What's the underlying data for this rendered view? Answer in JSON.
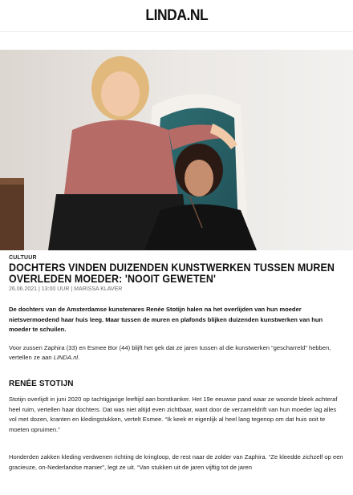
{
  "header": {
    "logo_text": "LINDA.NL"
  },
  "hero": {
    "image": "photo-two-women-mother-daughters"
  },
  "article": {
    "category": "CULTUUR",
    "title": "DOCHTERS VINDEN DUIZENDEN KUNSTWERKEN TUSSEN MUREN OVERLEDEN MOEDER: 'NOOIT GEWETEN'",
    "date": "26.06.2021",
    "time": "13:00 UUR",
    "author": "MARISSA KLAVER",
    "meta_sep": "|",
    "lead": "De dochters van de Amsterdamse kunstenares Renée Stotijn halen na het overlijden van hun moeder nietsvermoedend haar huis leeg. Maar tussen de muren en plafonds blijken duizenden kunstwerken van hun moeder te schuilen.",
    "p1_text": "Voor zussen Zaphira (33) en Esmee Bor (44) blijft het gek dat ze jaren tussen al die kunstwerken “gescharreld” hebben, vertellen ze aan ",
    "p1_em": "LINDA.nl",
    "p1_end": ".",
    "subheading": "RENÉE STOTIJN",
    "p2": "Stotijn overlijdt in juni 2020 op tachtigjarige leeftijd aan borstkanker. Het 19e eeuwse pand waar ze woonde bleek achteraf heel ruim, vertellen haar dochters. Dat was niet altijd even zichtbaar, want door de verzameldrift van hun moeder lag alles vol met dozen, kranten en kledingstukken, vertelt Esmee. “Ik keek er eigenlijk al heel lang tegenop om dat huis ooit te moeten opruimen.”",
    "p3": "Honderden zakken kleding verdwenen richting de kringloop, de rest naar de zolder van Zaphira. “Ze kleedde zichzelf op een gracieuze, on-Nederlandse manier”, legt ze uit. “Van stukken uit de jaren vijftig tot de jaren"
  }
}
